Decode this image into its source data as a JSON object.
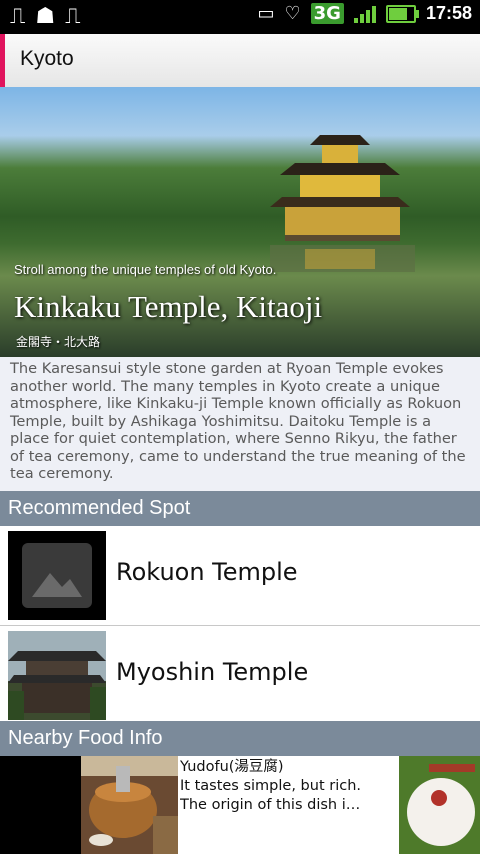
{
  "status_bar": {
    "left_icons": [
      "usb-icon",
      "android-icon",
      "usb-debug-icon"
    ],
    "network": "3G",
    "time": "17:58"
  },
  "header": {
    "title": "Kyoto"
  },
  "hero": {
    "tagline": "Stroll among the unique temples of old Kyoto.",
    "title": "Kinkaku Temple, Kitaoji",
    "subtitle": "金閣寺・北大路"
  },
  "description": "The Karesansui style stone garden at Ryoan Temple evokes another world. The many temples in Kyoto create a unique atmosphere, like Kinkaku-ji Temple known officially as Rokuon Temple, built by Ashikaga Yoshimitsu. Daitoku Temple is a place for quiet contemplation, where Senno Rikyu, the father of tea ceremony, came to understand the true meaning of the tea ceremony.",
  "recommended": {
    "heading": "Recommended Spot",
    "items": [
      {
        "name": "Rokuon Temple",
        "thumb": "placeholder-image-icon"
      },
      {
        "name": "Myoshin Temple",
        "thumb": "temple-photo"
      }
    ]
  },
  "food": {
    "heading": "Nearby Food Info",
    "title": "Yudofu(湯豆腐)",
    "line1": "It tastes simple, but rich.",
    "line2": "The origin of this dish i…"
  }
}
